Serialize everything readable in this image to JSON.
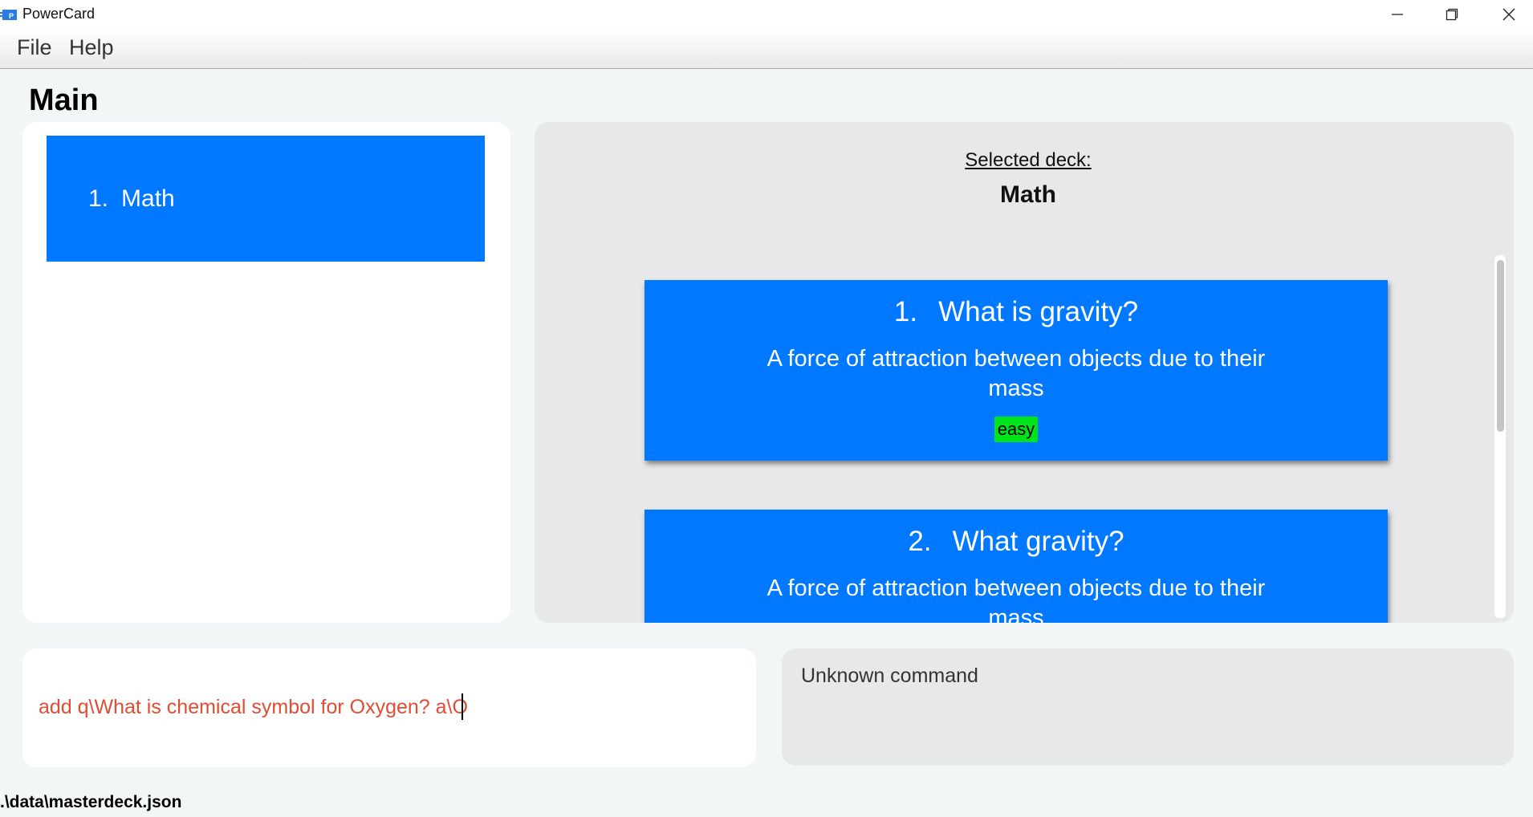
{
  "window": {
    "title": "PowerCard"
  },
  "menu": [
    "File",
    "Help"
  ],
  "page": {
    "title": "Main"
  },
  "decks": [
    {
      "index": "1.",
      "name": "Math"
    }
  ],
  "selected": {
    "label": "Selected deck:",
    "name": "Math"
  },
  "cards": [
    {
      "index": "1.",
      "question": "What is gravity?",
      "answer": "A force of attraction between objects due to their mass",
      "tag": "easy"
    },
    {
      "index": "2.",
      "question": "What gravity?",
      "answer": "A force of attraction between objects due to their mass"
    }
  ],
  "command": {
    "value": "add q\\What is chemical symbol for Oxygen? a\\O"
  },
  "result": {
    "text": "Unknown command"
  },
  "status": {
    "path": ".\\data\\masterdeck.json"
  },
  "colors": {
    "accent": "#0078ff",
    "tag_easy": "#00e51a",
    "command_text": "#e14c32"
  },
  "icons": [
    "app-icon",
    "minimize-icon",
    "maximize-icon",
    "close-icon"
  ]
}
